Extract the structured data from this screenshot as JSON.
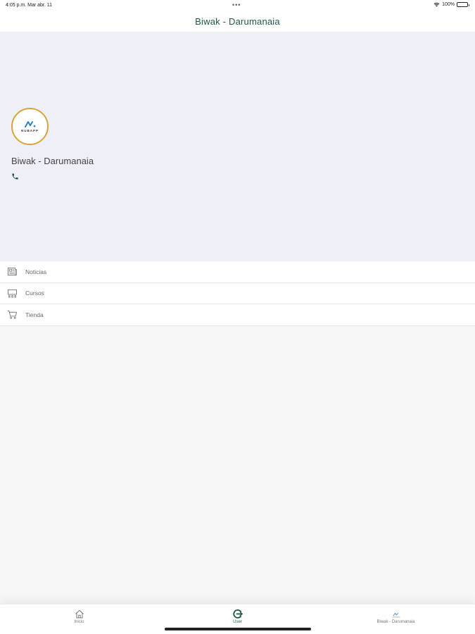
{
  "status_bar": {
    "time": "4:05 p.m.   Mar abr. 11",
    "dots": "•••",
    "battery": "100%"
  },
  "nav": {
    "title": "Biwak - Darumanaia"
  },
  "profile": {
    "logo_text": "NUBAPP",
    "name": "Biwak - Darumanaia",
    "phone_icon": "phone-icon"
  },
  "menu": {
    "items": [
      {
        "label": "Noticias",
        "icon": "newspaper-icon"
      },
      {
        "label": "Cursos",
        "icon": "classroom-icon"
      },
      {
        "label": "Tienda",
        "icon": "cart-icon"
      }
    ]
  },
  "tabs": [
    {
      "label": "Inicio",
      "icon": "home-icon",
      "active": false
    },
    {
      "label": "User",
      "icon": "user-exit-icon",
      "active": true
    },
    {
      "label": "Biwak - Darumanaia",
      "icon": "center-icon",
      "active": false
    }
  ],
  "colors": {
    "accent": "#1f5a3f",
    "header_bg": "#efeff7",
    "logo_border": "#d9a437"
  }
}
